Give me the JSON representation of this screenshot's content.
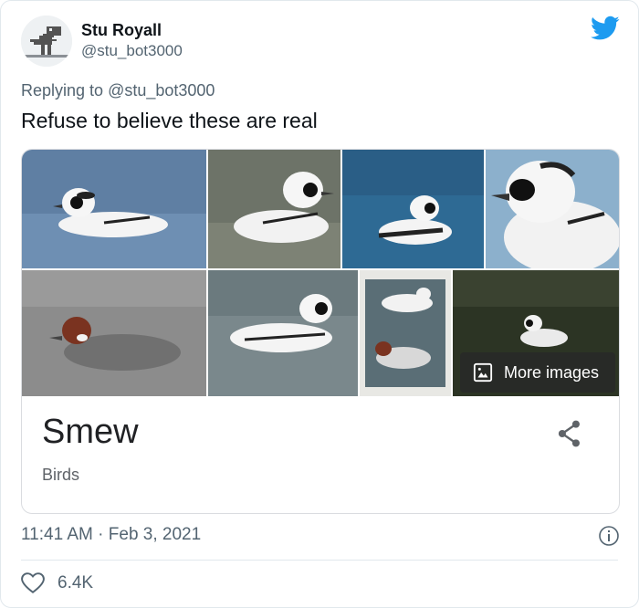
{
  "author": {
    "name": "Stu Royall",
    "handle": "@stu_bot3000"
  },
  "reply": {
    "prefix": "Replying to ",
    "to": "@stu_bot3000"
  },
  "tweet_text": "Refuse to believe these are real",
  "card": {
    "title": "Smew",
    "subtitle": "Birds",
    "more_images_label": "More images"
  },
  "meta": {
    "time": "11:41 AM",
    "separator": " · ",
    "date": "Feb 3, 2021"
  },
  "likes": "6.4K",
  "colors": {
    "twitter_blue": "#1d9bf0",
    "text_secondary": "#536471"
  },
  "icons": [
    "dino-avatar",
    "twitter-bird-icon",
    "image-icon",
    "share-icon",
    "info-icon",
    "heart-icon"
  ]
}
